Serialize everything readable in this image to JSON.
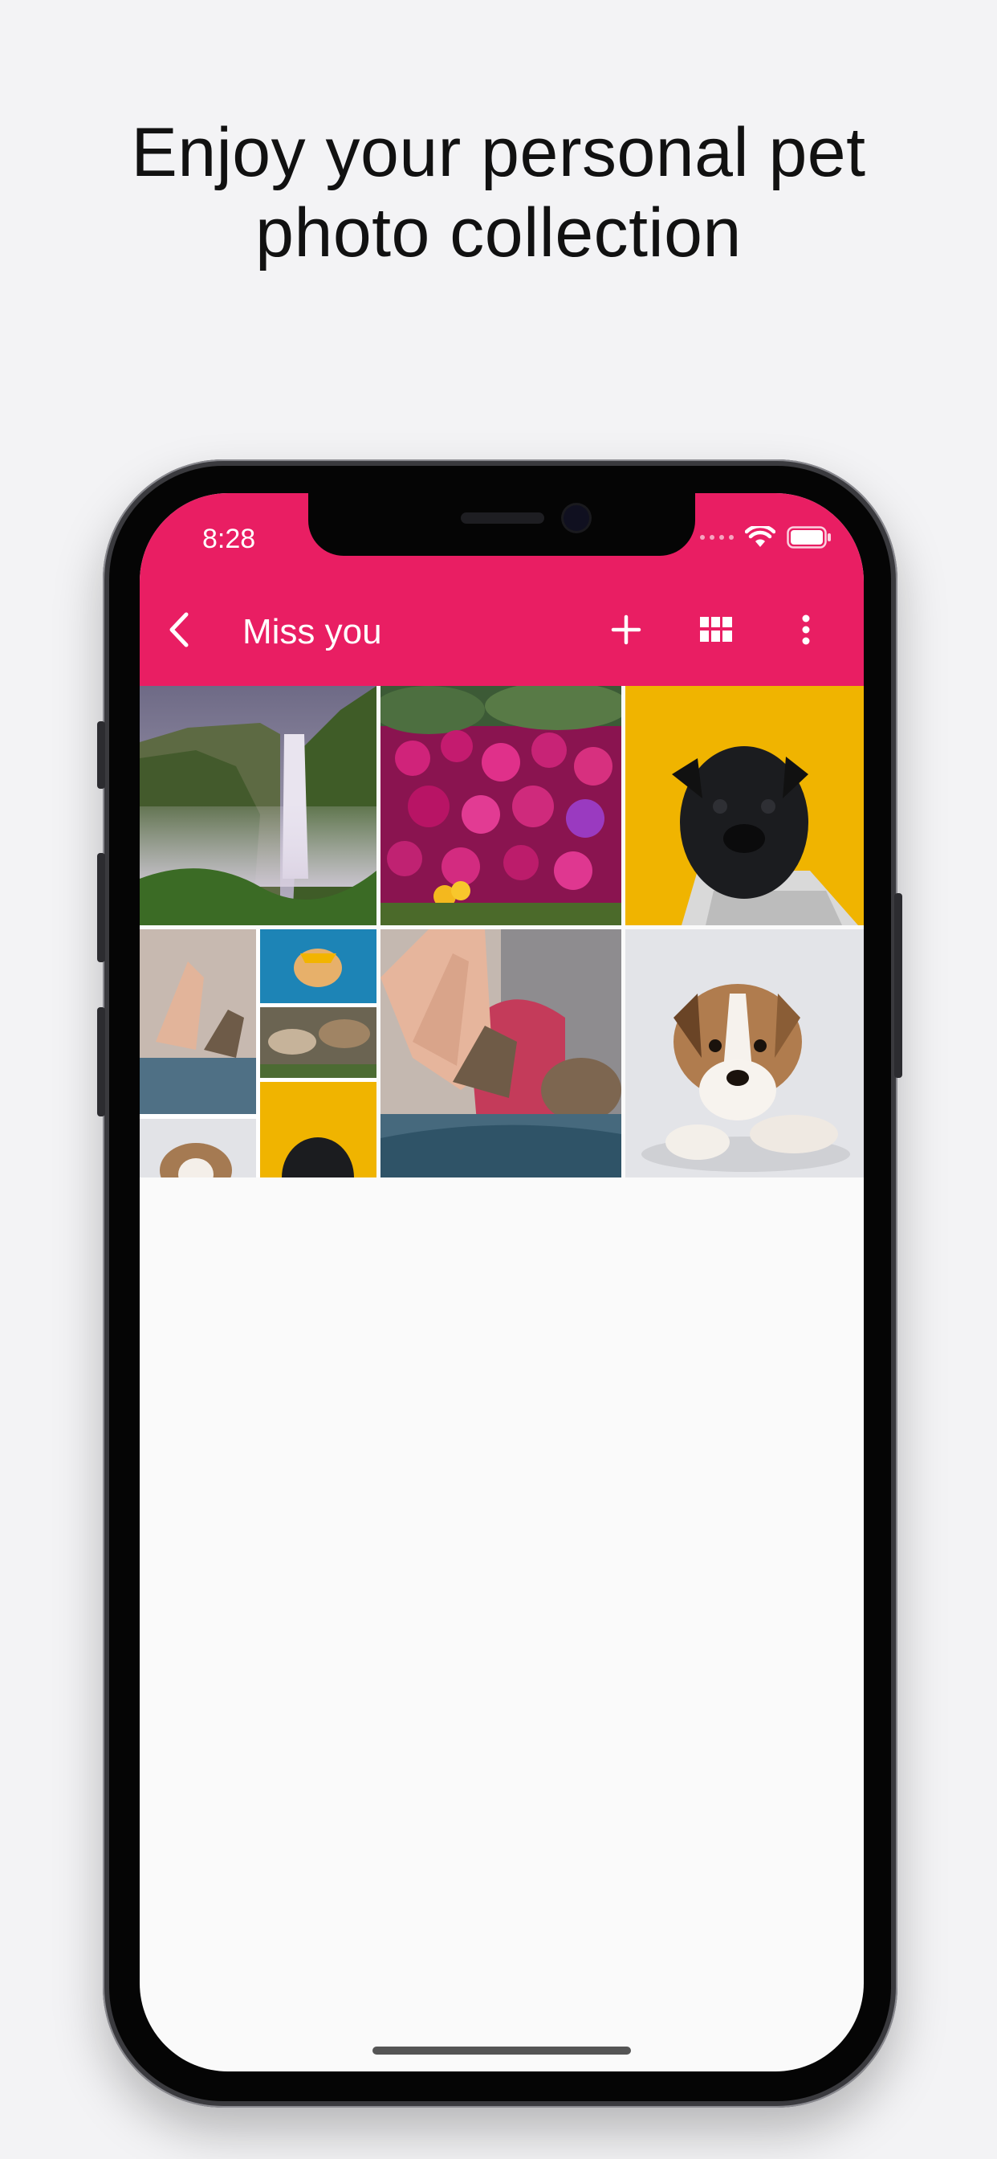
{
  "headline": {
    "line1": "Enjoy your personal pet",
    "line2": "photo collection"
  },
  "status_bar": {
    "time": "8:28",
    "icons": [
      "signal-dots-icon",
      "wifi-icon",
      "battery-icon"
    ]
  },
  "app_bar": {
    "title": "Miss you",
    "actions": [
      "back-icon",
      "add-icon",
      "grid-view-icon",
      "more-vert-icon"
    ]
  },
  "colors": {
    "accent": "#e91e63",
    "pug_background": "#f0b400",
    "page_background": "#f3f3f5"
  },
  "photos": [
    {
      "subject": "waterfall"
    },
    {
      "subject": "pink flowers"
    },
    {
      "subject": "black pug on yellow"
    },
    {
      "subject": "collage of pet photos"
    },
    {
      "subject": "high five with cat"
    },
    {
      "subject": "puppy"
    }
  ]
}
